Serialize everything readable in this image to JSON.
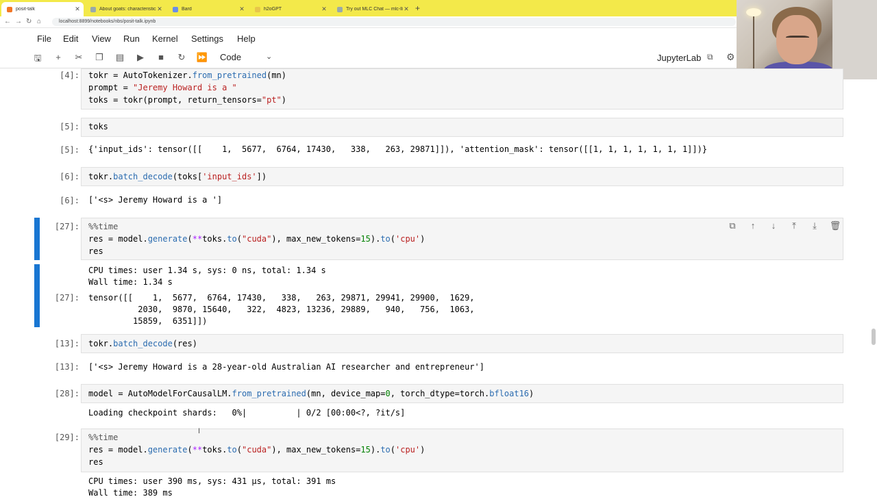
{
  "browser": {
    "tabs": [
      {
        "label": "posit-talk",
        "active": true
      },
      {
        "label": "About goats: characteristics a...",
        "active": false
      },
      {
        "label": "Bard",
        "active": false
      },
      {
        "label": "h2oGPT",
        "active": false
      },
      {
        "label": "Try out MLC Chat — mlc-llm 0...",
        "active": false
      }
    ],
    "url": "localhost:8899/notebooks/nbs/posit-talk.ipynb"
  },
  "menu": [
    "File",
    "Edit",
    "View",
    "Run",
    "Kernel",
    "Settings",
    "Help"
  ],
  "toolbar": {
    "cell_type": "Code",
    "app_name": "JupyterLab"
  },
  "cells": {
    "c4": {
      "prompt": "[4]:",
      "lines": [
        "tokr = AutoTokenizer.from_pretrained(mn)",
        "prompt = \"Jeremy Howard is a \"",
        "toks = tokr(prompt, return_tensors=\"pt\")"
      ]
    },
    "c5": {
      "prompt": "[5]:",
      "code": "toks",
      "out_prompt": "[5]:",
      "output": "{'input_ids': tensor([[    1,  5677,  6764, 17430,   338,   263, 29871]]), 'attention_mask': tensor([[1, 1, 1, 1, 1, 1, 1]])}"
    },
    "c6": {
      "prompt": "[6]:",
      "code": "tokr.batch_decode(toks['input_ids'])",
      "out_prompt": "[6]:",
      "output": "['<s> Jeremy Howard is a ']"
    },
    "c27": {
      "prompt": "[27]:",
      "lines": [
        "%%time",
        "res = model.generate(**toks.to(\"cuda\"), max_new_tokens=15).to('cpu')",
        "res"
      ],
      "stdout": [
        "CPU times: user 1.34 s, sys: 0 ns, total: 1.34 s",
        "Wall time: 1.34 s"
      ],
      "out_prompt": "[27]:",
      "output": [
        "tensor([[    1,  5677,  6764, 17430,   338,   263, 29871, 29941, 29900,  1629,",
        "          2030,  9870, 15640,   322,  4823, 13236, 29889,   940,   756,  1063,",
        "         15859,  6351]])"
      ]
    },
    "c13": {
      "prompt": "[13]:",
      "code": "tokr.batch_decode(res)",
      "out_prompt": "[13]:",
      "output": "['<s> Jeremy Howard is a 28-year-old Australian AI researcher and entrepreneur']"
    },
    "c28": {
      "prompt": "[28]:",
      "code": "model = AutoModelForCausalLM.from_pretrained(mn, device_map=0, torch_dtype=torch.bfloat16)",
      "output": "Loading checkpoint shards:   0%|          | 0/2 [00:00<?, ?it/s]"
    },
    "c29": {
      "prompt": "[29]:",
      "lines": [
        "%%time",
        "res = model.generate(**toks.to(\"cuda\"), max_new_tokens=15).to('cpu')",
        "res"
      ],
      "stdout": [
        "CPU times: user 390 ms, sys: 431 µs, total: 391 ms",
        "Wall time: 389 ms"
      ]
    }
  },
  "colors": {
    "tabbar": "#f3e94a",
    "active_cell": "#1976d2",
    "cell_bg": "#f5f5f5"
  }
}
